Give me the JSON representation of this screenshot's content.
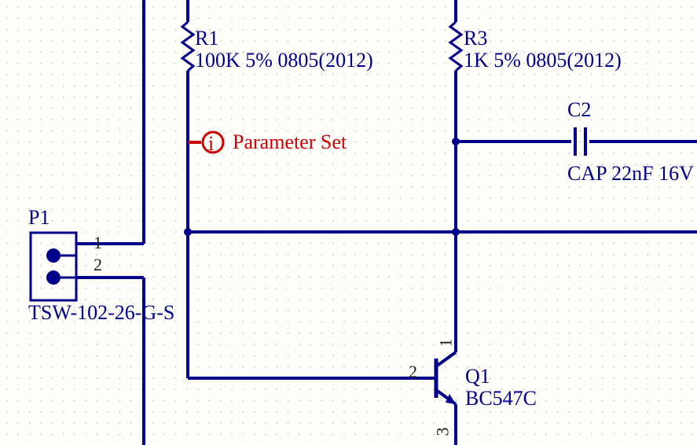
{
  "components": {
    "R1": {
      "designator": "R1",
      "value": "100K 5% 0805(2012)"
    },
    "R3": {
      "designator": "R3",
      "value": "1K 5% 0805(2012)"
    },
    "C2": {
      "designator": "C2",
      "value": "CAP 22nF 16V"
    },
    "P1": {
      "designator": "P1",
      "value": "TSW-102-26-G-S",
      "pin1": "1",
      "pin2": "2"
    },
    "Q1": {
      "designator": "Q1",
      "value": "BC547C",
      "pin1": "1",
      "pin2": "2",
      "pin3": "3"
    }
  },
  "directives": {
    "paramset": {
      "label": "Parameter Set",
      "icon_text": "i"
    }
  }
}
